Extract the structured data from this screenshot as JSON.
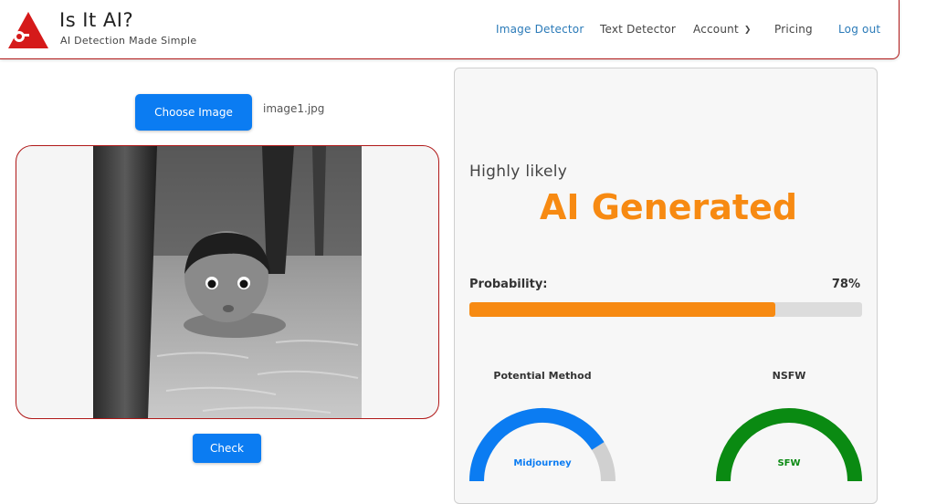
{
  "header": {
    "brand_title": "Is It AI?",
    "brand_subtitle": "AI Detection Made Simple",
    "nav": {
      "image_detector": "Image Detector",
      "text_detector": "Text Detector",
      "account": "Account",
      "pricing": "Pricing",
      "logout": "Log out"
    }
  },
  "upload": {
    "choose_label": "Choose Image",
    "filename": "image1.jpg",
    "check_label": "Check"
  },
  "result": {
    "likelihood": "Highly likely",
    "verdict": "AI Generated",
    "probability_label": "Probability:",
    "probability_text": "78%",
    "probability_fraction": 0.78,
    "method": {
      "title": "Potential Method",
      "value": "Midjourney",
      "fraction": 0.82
    },
    "nsfw": {
      "title": "NSFW",
      "value": "SFW",
      "fraction": 1.0
    }
  },
  "colors": {
    "primary_button": "#0b7cf2",
    "accent_orange": "#f78a12",
    "header_border": "#b01818",
    "method_gauge": "#0b7cf2",
    "nsfw_gauge": "#0a8a12",
    "gauge_track": "#d0d0d0",
    "logo_red": "#d51a1a"
  }
}
